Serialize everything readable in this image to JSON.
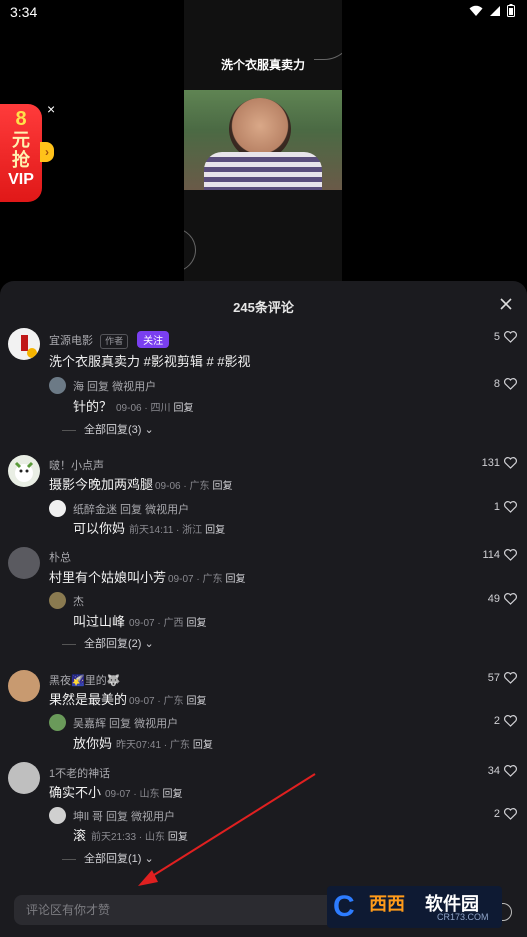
{
  "status_bar": {
    "time": "3:34"
  },
  "video": {
    "caption": "洗个衣服真卖力"
  },
  "promo": {
    "line1": "8",
    "line2": "元",
    "line3": "抢",
    "line4": "VIP",
    "close": "×",
    "arrow": "›"
  },
  "comments_panel": {
    "title": "245条评论",
    "input_placeholder": "评论区有你才赞",
    "author_post": {
      "name": "宜源电影",
      "author_tag": "作者",
      "follow_label": "关注",
      "text": "洗个衣服真卖力  #影视剪辑 # #影视",
      "likes": "5",
      "replies": [
        {
          "name": "海 回复 微视用户",
          "text": "针的？",
          "date": "09-06 · 四川",
          "reply_label": "回复",
          "likes": "8"
        }
      ],
      "expand_label": "全部回复(3)"
    },
    "comments": [
      {
        "name": "啵！小点声",
        "text": "摄影今晚加两鸡腿",
        "date": "09-06 · 广东",
        "reply_label": "回复",
        "likes": "131",
        "replies": [
          {
            "name": "纸醉金迷 回复 微视用户",
            "text": "可以你妈",
            "date": "前天14:11 · 浙江",
            "reply_label": "回复",
            "likes": "1"
          }
        ]
      },
      {
        "name": "朴总",
        "text": "村里有个姑娘叫小芳",
        "date": "09-07 · 广东",
        "reply_label": "回复",
        "likes": "114",
        "replies": [
          {
            "name": "杰",
            "text": "叫过山峰",
            "date": "09-07 · 广西",
            "reply_label": "回复",
            "likes": "49"
          }
        ],
        "expand_label": "全部回复(2)"
      },
      {
        "name": "黑夜🌠里的🐺",
        "text": "果然是最美的",
        "date": "09-07 · 广东",
        "reply_label": "回复",
        "likes": "57",
        "replies": [
          {
            "name": "吴嘉辉 回复 微视用户",
            "text": "放你妈",
            "date": "昨天07:41 · 广东",
            "reply_label": "回复",
            "likes": "2"
          }
        ]
      },
      {
        "name": "1不老的神话",
        "text": "确实不小",
        "date": "09-07 · 山东",
        "reply_label": "回复",
        "likes": "34",
        "replies": [
          {
            "name": "坤ll 哥 回复 微视用户",
            "text": "滚",
            "date": "前天21:33 · 山东",
            "reply_label": "回复",
            "likes": "2"
          }
        ],
        "expand_label": "全部回复(1)"
      }
    ]
  },
  "watermark": {
    "logo": "C",
    "brand1": "西西",
    "brand2": "软件园",
    "domain": "CR173.COM"
  },
  "colors": {
    "sheet_bg": "#1b1b1f",
    "follow_bg": "#7a3ff0",
    "arrow": "#e02020"
  }
}
